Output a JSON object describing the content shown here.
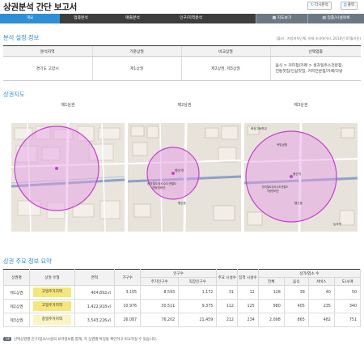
{
  "header": {
    "title": "상권분석 간단 보고서",
    "refresh_label": "다시분석",
    "print_label": "출력"
  },
  "tabs": [
    {
      "label": "개요",
      "active": true
    },
    {
      "label": "업종분석",
      "active": false
    },
    {
      "label": "매출분석",
      "active": false
    },
    {
      "label": "인구/지역분석",
      "active": false
    }
  ],
  "right_tabs": [
    {
      "label": "지도보기"
    },
    {
      "label": "업종/시설목록"
    }
  ],
  "settings": {
    "title": "분석 설정 정보",
    "source": "(출처 : 지방자치단체, 자체 조사데이터, 2016년 07월기준)",
    "headers": [
      "분석지역",
      "기준상권",
      "비교상권",
      "선택업종"
    ],
    "row": {
      "region": "경기도 고양시",
      "base": "제1상권",
      "compare": "제2상권, 제3상권",
      "industry": [
        "음식 > 커피점/카페 > 생과일주스전문점,",
        "전통찻집/인삼찻집, 커피전문점/카페/다방"
      ]
    }
  },
  "maps": {
    "title": "상권지도",
    "items": [
      {
        "label": "제1상권"
      },
      {
        "label": "제2상권",
        "poi": [
          "행신역",
          "한국철도공사수도권철도",
          "차량정비단"
        ],
        "poi2": "행신동"
      },
      {
        "label": "제3상권",
        "poi": [
          "행신역",
          "한국철도공사수도권철도",
          "차량정비단"
        ],
        "poi2": "행신동",
        "poi3": "화정고등학교",
        "poi4": "옥빛공원",
        "poi5": "능곡역"
      }
    ]
  },
  "summary": {
    "title": "상권 주요 정보 요약",
    "headers": {
      "area_name": "상권명",
      "area_type": "상권 유형",
      "size": "면적",
      "households": "가구수",
      "population": "인구수",
      "resident": "주거인구수",
      "worker": "직장인구수",
      "facilities": "주요 시설수",
      "gathering": "집객 시설수",
      "stores": "상가/업소 수",
      "total": "전체",
      "food": "음식",
      "service": "서비스",
      "retail": "도/소매"
    },
    "rows": [
      {
        "name": "제1상권",
        "type": "고밀주거지역",
        "area": "404,892㎡",
        "households": "3,105",
        "resident": "8,593",
        "worker": "1,172",
        "facilities": "31",
        "gathering": "12",
        "total": "128",
        "food": "38",
        "service": "40",
        "retail": "50"
      },
      {
        "name": "제2상권",
        "type": "고밀주거지역",
        "area": "1,422,918㎡",
        "households": "10,976",
        "resident": "30,511",
        "worker": "9,375",
        "facilities": "112",
        "gathering": "125",
        "total": "980",
        "food": "405",
        "service": "235",
        "retail": "340"
      },
      {
        "name": "제3상권",
        "type": "중밀주거지역",
        "area": "3,543,226㎡",
        "households": "26,087",
        "resident": "76,202",
        "worker": "21,459",
        "facilities": "212",
        "gathering": "234",
        "total": "2,098",
        "food": "865",
        "service": "482",
        "retail": "751"
      }
    ]
  },
  "tip": {
    "tag": "TIP",
    "text": "선택상권별 인구/업소/시설의 요약정보를 통해, 각 상권별 특징을 확인하고 비교하실 수 있습니다."
  },
  "colors": {
    "accent": "#2d8fd5",
    "tabbar": "#3d3d3d",
    "circle_fill": "#e59be6",
    "circle_stroke": "#c63fd0",
    "badge": "#f5e77c"
  }
}
